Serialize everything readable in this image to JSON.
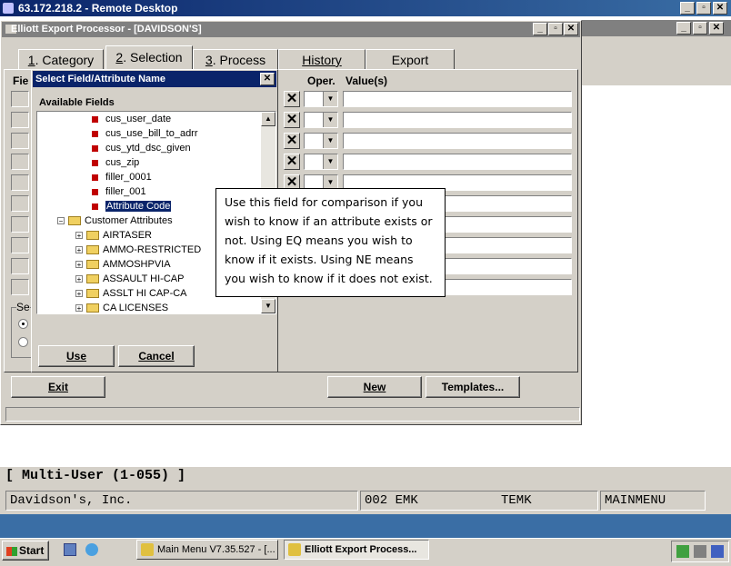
{
  "remote_desktop": {
    "title": "63.172.218.2 - Remote Desktop"
  },
  "app": {
    "title": "Elliott Export Processor - [DAVIDSON'S]"
  },
  "tabs": [
    {
      "num": "1",
      "label": ". Category"
    },
    {
      "num": "2",
      "label": ". Selection"
    },
    {
      "num": "3",
      "label": ". Process"
    },
    {
      "num": "",
      "label": "History"
    },
    {
      "num": "",
      "label": "Export"
    }
  ],
  "grid": {
    "col_field": "Fie",
    "col_oper": "Oper.",
    "col_values": "Value(s)",
    "sel_label": "Se"
  },
  "dialog": {
    "title": "Select Field/Attribute Name",
    "available_label": "Available Fields",
    "fields": [
      "cus_user_date",
      "cus_use_bill_to_adrr",
      "cus_ytd_dsc_given",
      "cus_zip",
      "filler_0001",
      "filler_001",
      "Attribute Code"
    ],
    "group": "Customer Attributes",
    "attributes": [
      "AIRTASER",
      "AMMO-RESTRICTED",
      "AMMOSHPVIA",
      "ASSAULT HI-CAP",
      "ASSLT HI CAP-CA",
      "CA LICENSES"
    ],
    "use_label": "Use",
    "cancel_label": "Cancel"
  },
  "tooltip": {
    "text": "Use this field for comparison if you wish to know if an attribute exists or not.  Using EQ means you wish to know if it exists.  Using NE means you wish to know if it does not exist."
  },
  "buttons": {
    "exit": "Exit",
    "new": "New",
    "templates": "Templates..."
  },
  "status": {
    "mode": "[ Multi-User (1-055) ]",
    "company": "Davidson's, Inc.",
    "code": "002 EMK",
    "user": "TEMK",
    "menu": "MAINMENU"
  },
  "taskbar": {
    "start": "Start",
    "task1": "Main Menu V7.35.527 - [...",
    "task2": "Elliott Export Process..."
  }
}
